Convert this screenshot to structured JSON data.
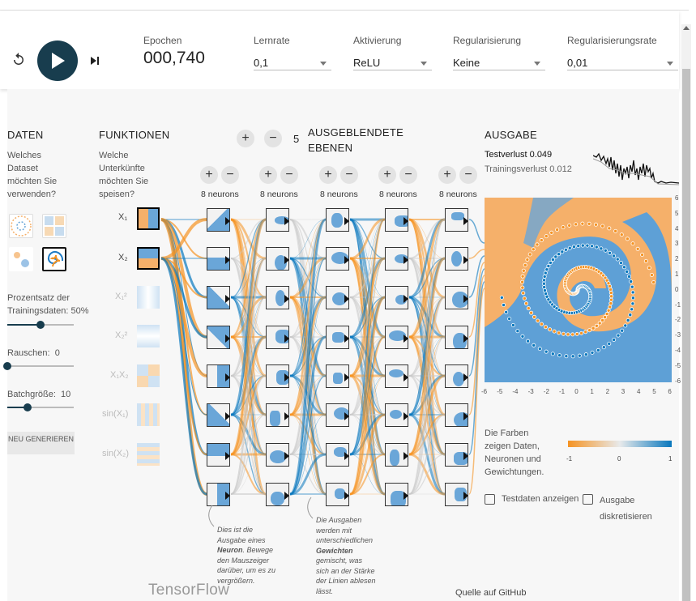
{
  "controls": {
    "epochs_label": "Epochen",
    "epochs_value": "000,740",
    "learning_rate": {
      "label": "Lernrate",
      "value": "0,1"
    },
    "activation": {
      "label": "Aktivierung",
      "value": "ReLU"
    },
    "regularization": {
      "label": "Regularisierung",
      "value": "Keine"
    },
    "regularization_rate": {
      "label": "Regularisierungsrate",
      "value": "0,01"
    }
  },
  "data_panel": {
    "title": "DATEN",
    "question": "Welches Dataset möchten Sie verwenden?",
    "ratio_label": "Prozentsatz der Trainingsdaten:",
    "ratio_value": "50%",
    "ratio_fraction": 0.5,
    "noise_label": "Rauschen:",
    "noise_value": "0",
    "noise_fraction": 0,
    "batch_label": "Batchgröße:",
    "batch_value": "10",
    "batch_fraction": 0.3,
    "regenerate_label": "NEU GENERIEREN"
  },
  "features_panel": {
    "title": "FUNKTIONEN",
    "question": "Welche Unterkünfte möchten Sie speisen?",
    "features": [
      "X₁",
      "X₂",
      "X₁²",
      "X₂²",
      "X₁X₂",
      "sin(X₁)",
      "sin(X₂)"
    ]
  },
  "hidden": {
    "count": "5",
    "title": "AUSGEBLENDETE EBENEN",
    "layer_label": "8 neurons",
    "neuron_note": [
      "Dies ist die",
      "Ausgabe eines",
      "Neuron",
      ". Bewege",
      "den Mauszeiger",
      "darüber, um es zu",
      "vergrößern."
    ],
    "weight_note": [
      "Die Ausgaben",
      "werden mit",
      "unterschiedlichen",
      "Gewichten",
      "gemischt, was",
      "sich an der Stärke",
      "der Linien ablesen",
      "lässt."
    ]
  },
  "output": {
    "title": "AUSGABE",
    "test_loss_label": "Testverlust",
    "test_loss": "0.049",
    "train_loss_label": "Trainingsverlust",
    "train_loss": "0.012",
    "y_ticks": [
      "6",
      "5",
      "4",
      "3",
      "2",
      "1",
      "0",
      "-1",
      "-2",
      "-3",
      "-4",
      "-5",
      "-6"
    ],
    "x_ticks": [
      "-6",
      "-5",
      "-4",
      "-3",
      "-2",
      "-1",
      "0",
      "1",
      "2",
      "3",
      "4",
      "5",
      "6"
    ],
    "legend_text": "Die Farben zeigen Daten, Neuronen und Gewichtungen.",
    "scale_labels": [
      "-1",
      "0",
      "1"
    ],
    "show_test_label": "Testdaten anzeigen",
    "discretize_label": "Ausgabe diskretisieren"
  },
  "colors": {
    "orange": "#f59322",
    "blue": "#0877bd",
    "dark": "#183d4e"
  },
  "footer": {
    "brand": "TensorFlow",
    "github": "Quelle auf GitHub"
  }
}
